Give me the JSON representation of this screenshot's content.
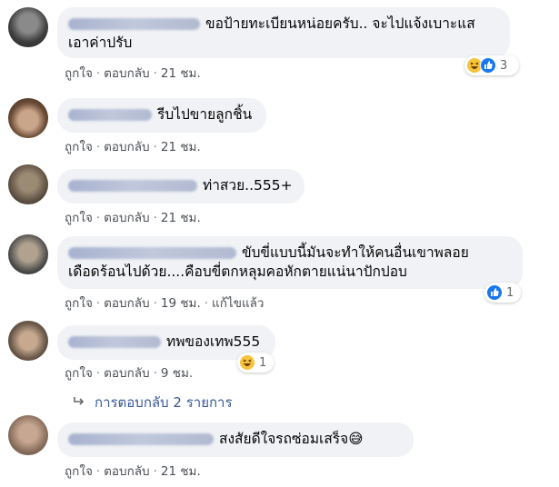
{
  "comments": [
    {
      "text_lines": [
        "ขอป้ายทะเบียนหน่อยครับ.. จะไปแจ้งเบาะแส",
        "เอาค่าปรับ"
      ],
      "like": "ถูกใจ",
      "reply": "ตอบกลับ",
      "time": "21 ชม.",
      "reaction": {
        "icons": [
          "haha-icon",
          "like-icon"
        ],
        "count": "3"
      }
    },
    {
      "text_lines": [
        "รีบไปขายลูกชิ้น"
      ],
      "like": "ถูกใจ",
      "reply": "ตอบกลับ",
      "time": "21 ชม."
    },
    {
      "text_lines": [
        "ท่าสวย..555+"
      ],
      "like": "ถูกใจ",
      "reply": "ตอบกลับ",
      "time": "21 ชม."
    },
    {
      "text_lines": [
        "ขับขี่แบบนี้มันจะทำให้คนอื่นเขาพลอย",
        "เดือดร้อนไปด้วย....คือบขี่ตกหลุมคอหักตายแน่นาปักปอบ"
      ],
      "like": "ถูกใจ",
      "reply": "ตอบกลับ",
      "time": "19 ชม.",
      "edited": "แก้ไขแล้ว",
      "reaction": {
        "icons": [
          "like-icon"
        ],
        "count": "1"
      }
    },
    {
      "text_lines": [
        "ทพของเทพ555"
      ],
      "like": "ถูกใจ",
      "reply": "ตอบกลับ",
      "time": "9 ชม.",
      "reaction": {
        "icons": [
          "haha-icon"
        ],
        "count": "1"
      }
    },
    {
      "text_lines": [
        "สงสัยดีใจรถซ่อมเสร็จ😅"
      ],
      "like": "ถูกใจ",
      "reply": "ตอบกลับ",
      "time": "21 ชม."
    }
  ],
  "replies_link": "การตอบกลับ 2 รายการ",
  "colors": {
    "link": "#385898",
    "bubble": "#f0f2f5",
    "like_blue": "#1877f2",
    "haha_yellow": "#f7c33c"
  }
}
